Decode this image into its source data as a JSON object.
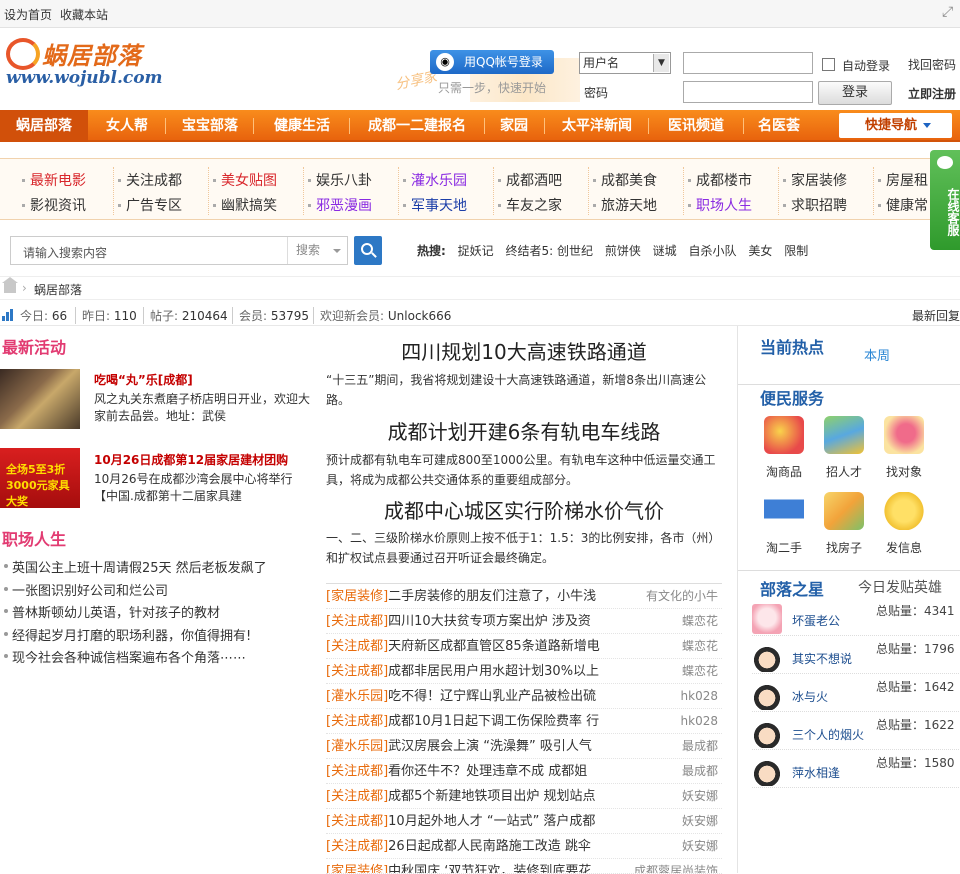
{
  "topbar": {
    "set_home": "设为首页",
    "bookmark": "收藏本站"
  },
  "header": {
    "logo_cn": "蜗居部落",
    "logo_en": "www.wojubl.com",
    "qq_login": "用QQ帐号登录",
    "qq_note": "只需一步，快速开始",
    "share_text": "分享家",
    "username_select": "用户名",
    "password_label": "密码",
    "auto_login": "自动登录",
    "login": "登录",
    "find_password": "找回密码",
    "register": "立即注册"
  },
  "nav": {
    "items": [
      "蜗居部落",
      "女人帮",
      "宝宝部落",
      "健康生活",
      "成都一二建报名",
      "家园",
      "太平洋新闻",
      "医讯频道",
      "名医荟"
    ],
    "quick_nav": "快捷导航"
  },
  "links": [
    [
      "最新电影",
      "影视资讯"
    ],
    [
      "关注成都",
      "广告专区"
    ],
    [
      "美女贴图",
      "幽默搞笑"
    ],
    [
      "娱乐八卦",
      "邪恶漫画"
    ],
    [
      "灌水乐园",
      "军事天地"
    ],
    [
      "成都酒吧",
      "车友之家"
    ],
    [
      "成都美食",
      "旅游天地"
    ],
    [
      "成都楼市",
      "职场人生"
    ],
    [
      "家居装修",
      "求职招聘"
    ],
    [
      "房屋租",
      "健康常"
    ]
  ],
  "links_colors": {
    "red": "#d8262b",
    "purple": "#8a2be2",
    "blue": "#1c3ea8",
    "default": "#333333"
  },
  "online_service": "在线客服",
  "search": {
    "placeholder": "请输入搜索内容",
    "category": "搜索",
    "hot_label": "热搜:",
    "hot_terms": [
      "捉妖记",
      "终结者5: 创世纪",
      "煎饼侠",
      "谜城",
      "自杀小队",
      "美女",
      "限制"
    ]
  },
  "breadcrumb": {
    "arrow": "›",
    "current": "蜗居部落"
  },
  "stats": {
    "today_label": "今日:",
    "today": "66",
    "yesterday_label": "昨日:",
    "yesterday": "110",
    "posts_label": "帖子:",
    "posts": "210464",
    "members_label": "会员:",
    "members": "53795",
    "welcome_label": "欢迎新会员:",
    "welcome": "Unlock666",
    "latest": "最新回复"
  },
  "left": {
    "activities_title": "最新活动",
    "activities": [
      {
        "title": "吃喝“丸”乐[成都]",
        "desc": "风之丸关东煮磨子桥店明日开业，欢迎大家前去品尝。地址：武侯"
      },
      {
        "title": "10月26日成都第12届家居建材团购",
        "desc": "10月26号在成都沙湾会展中心将举行【中国.成都第十二届家具建"
      }
    ],
    "ad_text": "全场5至3折 3000元家具大奖",
    "career_title": "职场人生",
    "career": [
      "英国公主上班十周请假25天  然后老板发飙了",
      "一张图识别好公司和烂公司",
      "普林斯顿幼儿英语，针对孩子的教材",
      "经得起岁月打磨的职场利器，你值得拥有!",
      "现今社会各种诚信档案遍布各个角落⋯⋯"
    ]
  },
  "middle": {
    "headlines": [
      {
        "title": "四川规划10大高速铁路通道",
        "desc": "“十三五”期间，我省将规划建设十大高速铁路通道，新增8条出川高速公路。"
      },
      {
        "title": "成都计划开建6条有轨电车线路",
        "desc": "预计成都有轨电车可建成800至1000公里。有轨电车这种中低运量交通工具，将成为成都公共交通体系的重要组成部分。"
      },
      {
        "title": "成都中心城区实行阶梯水价气价",
        "desc": "一、二、三级阶梯水价原则上按不低于1：1.5：3的比例安排，各市（州）和扩权试点县要通过召开听证会最终确定。"
      }
    ],
    "news": [
      {
        "cat": "[家居装修]",
        "title": "二手房装修的朋友们注意了，小牛浅",
        "author": "有文化的小牛"
      },
      {
        "cat": "[关注成都]",
        "title": "四川10大扶贫专项方案出炉 涉及资",
        "author": "蝶恋花"
      },
      {
        "cat": "[关注成都]",
        "title": "天府新区成都直管区85条道路新增电",
        "author": "蝶恋花"
      },
      {
        "cat": "[关注成都]",
        "title": "成都非居民用户用水超计划30%以上",
        "author": "蝶恋花"
      },
      {
        "cat": "[灌水乐园]",
        "title": "吃不得！辽宁辉山乳业产品被检出硫",
        "author": "hk028"
      },
      {
        "cat": "[关注成都]",
        "title": "成都10月1日起下调工伤保险费率 行",
        "author": "hk028"
      },
      {
        "cat": "[灌水乐园]",
        "title": "武汉房展会上演 “洗澡舞” 吸引人气",
        "author": "最成都"
      },
      {
        "cat": "[关注成都]",
        "title": "看你还牛不？处理违章不成 成都姐",
        "author": "最成都"
      },
      {
        "cat": "[关注成都]",
        "title": "成都5个新建地铁项目出炉 规划站点",
        "author": "妖安娜"
      },
      {
        "cat": "[关注成都]",
        "title": "10月起外地人才 “一站式” 落户成都",
        "author": "妖安娜"
      },
      {
        "cat": "[关注成都]",
        "title": "26日起成都人民南路施工改造 跳伞",
        "author": "妖安娜"
      },
      {
        "cat": "[家居装修]",
        "title": "中秋国庆 ‘双节狂欢，装修到底要花",
        "author": "成都蓉居尚装饰"
      }
    ]
  },
  "right": {
    "hot_title": "当前热点",
    "hot_tab": "本周",
    "service_title": "便民服务",
    "services": [
      {
        "label": "淘商品",
        "icon": "shopping-bag-icon",
        "color": "#e84a4a"
      },
      {
        "label": "招人才",
        "icon": "books-icon",
        "color": "#58a8e0"
      },
      {
        "label": "找对象",
        "icon": "hearts-icon",
        "color": "#f06b8a"
      },
      {
        "label": "淘二手",
        "icon": "cart-icon",
        "color": "#3e7fd6"
      },
      {
        "label": "找房子",
        "icon": "houses-icon",
        "color": "#f2a33a"
      },
      {
        "label": "发信息",
        "icon": "message-icon",
        "color": "#f2c233"
      }
    ],
    "stars_title": "部落之星",
    "stars_tab": "今日发贴英雄",
    "stars_count_label": "总贴量：",
    "stars": [
      {
        "name": "坏蛋老公",
        "count": "4341"
      },
      {
        "name": "其实不想说",
        "count": "1796"
      },
      {
        "name": "冰与火",
        "count": "1642"
      },
      {
        "name": "三个人的烟火",
        "count": "1622"
      },
      {
        "name": "萍水相逢",
        "count": "1580"
      }
    ]
  }
}
